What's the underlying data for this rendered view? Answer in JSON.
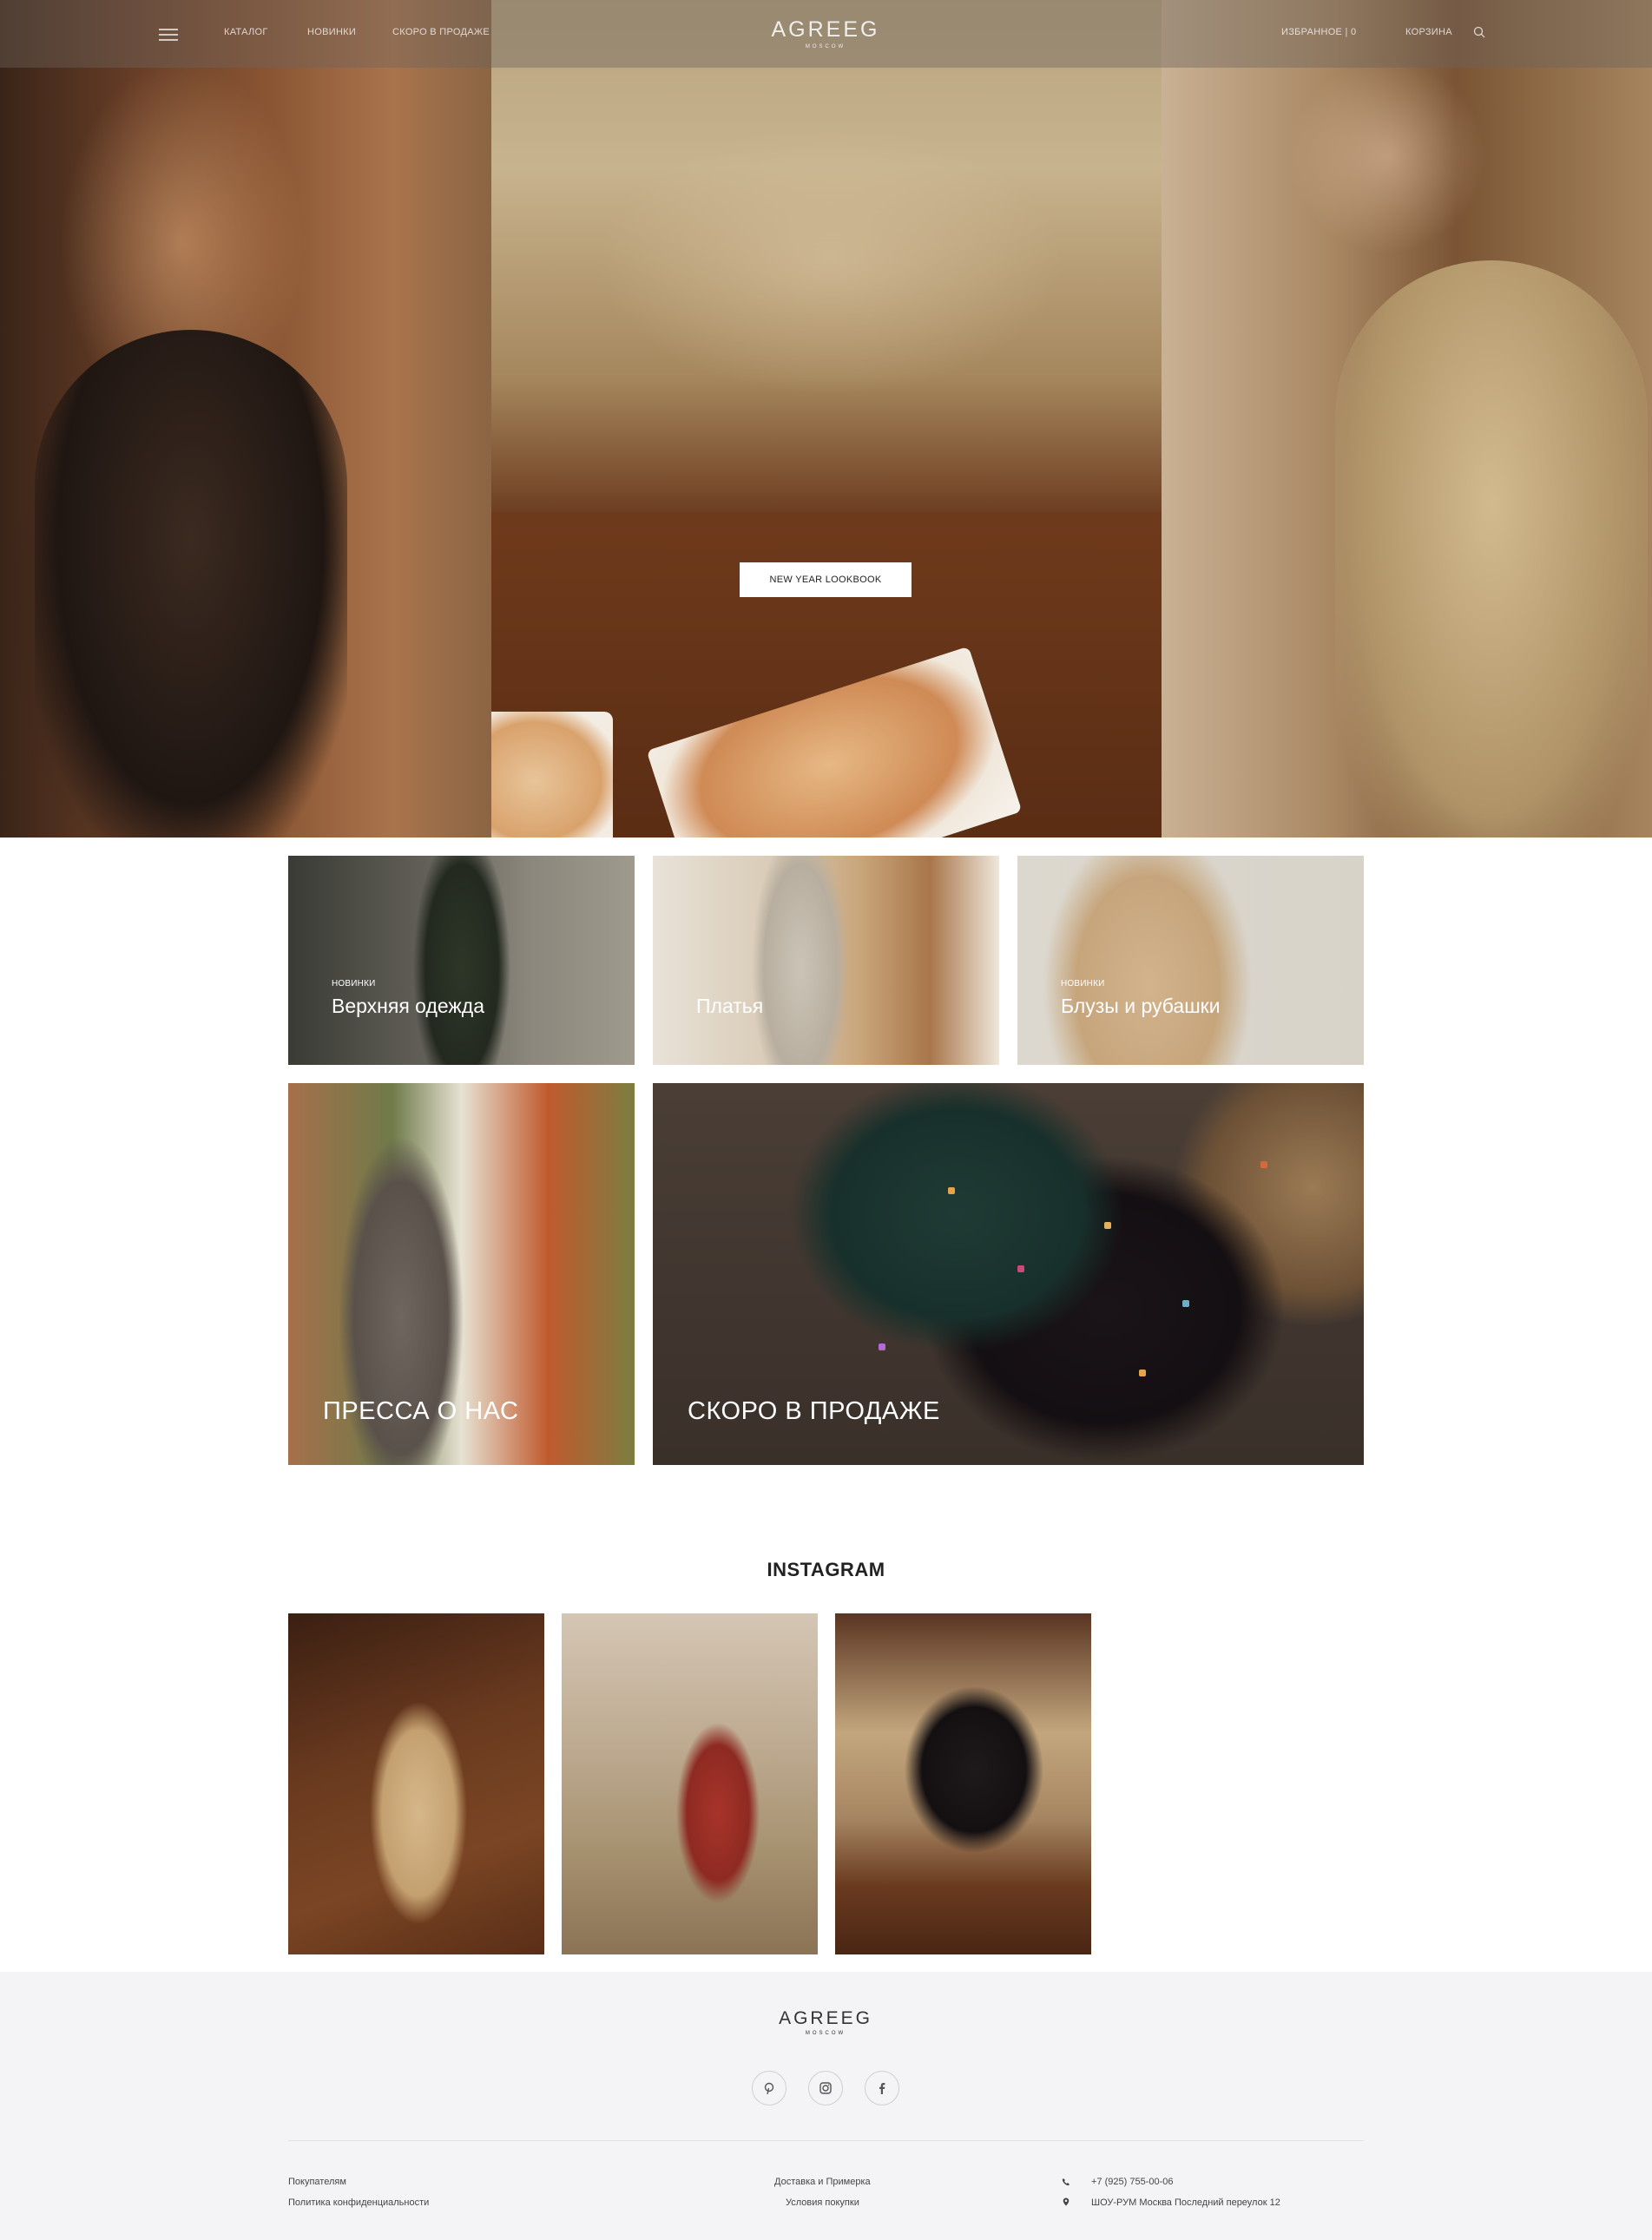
{
  "header": {
    "nav_left": [
      "КАТАЛОГ",
      "НОВИНКИ",
      "СКОРО В ПРОДАЖЕ"
    ],
    "logo": "AGREEG",
    "logo_sub": "MOSCOW",
    "nav_right": [
      "ИЗБРАННОЕ | 0",
      "КОРЗИНА"
    ],
    "icons": {
      "menu": "burger-menu-icon",
      "search": "search-icon"
    }
  },
  "hero": {
    "button_label": "NEW YEAR LOOKBOOK"
  },
  "categories": [
    {
      "tag": "НОВИНКИ",
      "title": "Верхняя одежда"
    },
    {
      "tag": "",
      "title": "Платья"
    },
    {
      "tag": "НОВИНКИ",
      "title": "Блузы и рубашки"
    },
    {
      "tag": "",
      "title": "ПРЕССА О НАС"
    },
    {
      "tag": "",
      "title": "СКОРО В ПРОДАЖЕ"
    }
  ],
  "instagram": {
    "heading": "INSTAGRAM"
  },
  "footer": {
    "logo": "AGREEG",
    "logo_sub": "MOSCOW",
    "social": [
      "pinterest-icon",
      "instagram-icon",
      "facebook-icon"
    ],
    "links_left": [
      "Покупателям",
      "Политика конфиденциальности"
    ],
    "links_mid": [
      "Доставка и Примерка",
      "Условия покупки"
    ],
    "phone": "+7 (925) 755-00-06",
    "address": "ШОУ-РУМ Москва Последний переулок 12"
  },
  "colors": {
    "footer_bg": "#f4f4f6",
    "text": "#222222",
    "header_overlay": "rgba(110,100,92,0.42)"
  }
}
